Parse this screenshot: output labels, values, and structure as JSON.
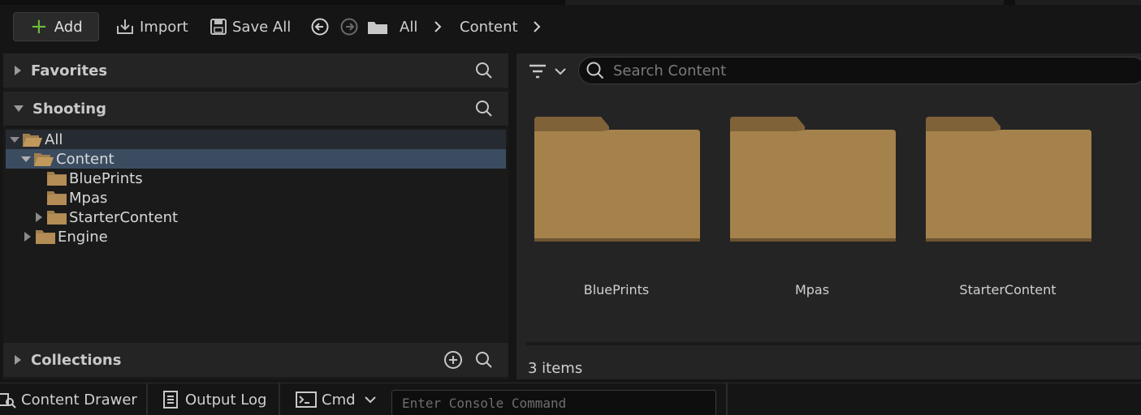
{
  "toolbar": {
    "add_label": "Add",
    "import_label": "Import",
    "save_all_label": "Save All",
    "breadcrumb": [
      "All",
      "Content"
    ]
  },
  "left_panel": {
    "favorites_label": "Favorites",
    "project_label": "Shooting",
    "collections_label": "Collections",
    "tree": {
      "all": "All",
      "content": "Content",
      "blueprints": "BluePrints",
      "mpas": "Mpas",
      "starter_content": "StarterContent",
      "engine": "Engine"
    }
  },
  "content_browser": {
    "search_placeholder": "Search Content",
    "items": [
      {
        "label": "BluePrints"
      },
      {
        "label": "Mpas"
      },
      {
        "label": "StarterContent"
      }
    ],
    "item_count": "3 items"
  },
  "bottom_bar": {
    "content_drawer": "Content Drawer",
    "output_log": "Output Log",
    "cmd": "Cmd",
    "console_placeholder": "Enter Console Command"
  },
  "colors": {
    "folder": "#a07f4c",
    "selection": "#3b4c60",
    "add_accent": "#6bbf3a"
  }
}
